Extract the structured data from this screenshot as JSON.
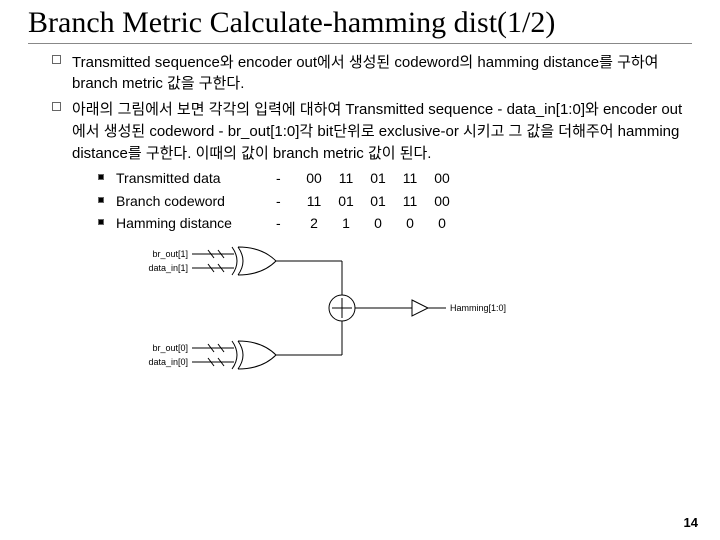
{
  "title": "Branch Metric Calculate-hamming dist(1/2)",
  "bullets": [
    "Transmitted sequence와 encoder out에서 생성된 codeword의 hamming distance를 구하여 branch metric 값을 구한다.",
    "아래의 그림에서 보면 각각의 입력에 대하여 Transmitted sequence - data_in[1:0]와 encoder out에서 생성된 codeword - br_out[1:0]각 bit단위로 exclusive-or 시키고 그 값을 더해주어 hamming distance를 구한다. 이때의 값이 branch metric 값이 된다."
  ],
  "table": {
    "rows": [
      {
        "label": "Transmitted data",
        "dash": "-",
        "v": [
          "00",
          "11",
          "01",
          "11",
          "00"
        ]
      },
      {
        "label": "Branch codeword",
        "dash": "-",
        "v": [
          "11",
          "01",
          "01",
          "11",
          "00"
        ]
      },
      {
        "label": "Hamming distance",
        "dash": "-",
        "v": [
          "2",
          "1",
          "0",
          "0",
          "0"
        ]
      }
    ]
  },
  "diagram": {
    "signals": {
      "top_a": "br_out[1]",
      "top_b": "data_in[1]",
      "bot_a": "br_out[0]",
      "bot_b": "data_in[0]",
      "out": "Hamming[1:0]"
    }
  },
  "pagenum": "14"
}
